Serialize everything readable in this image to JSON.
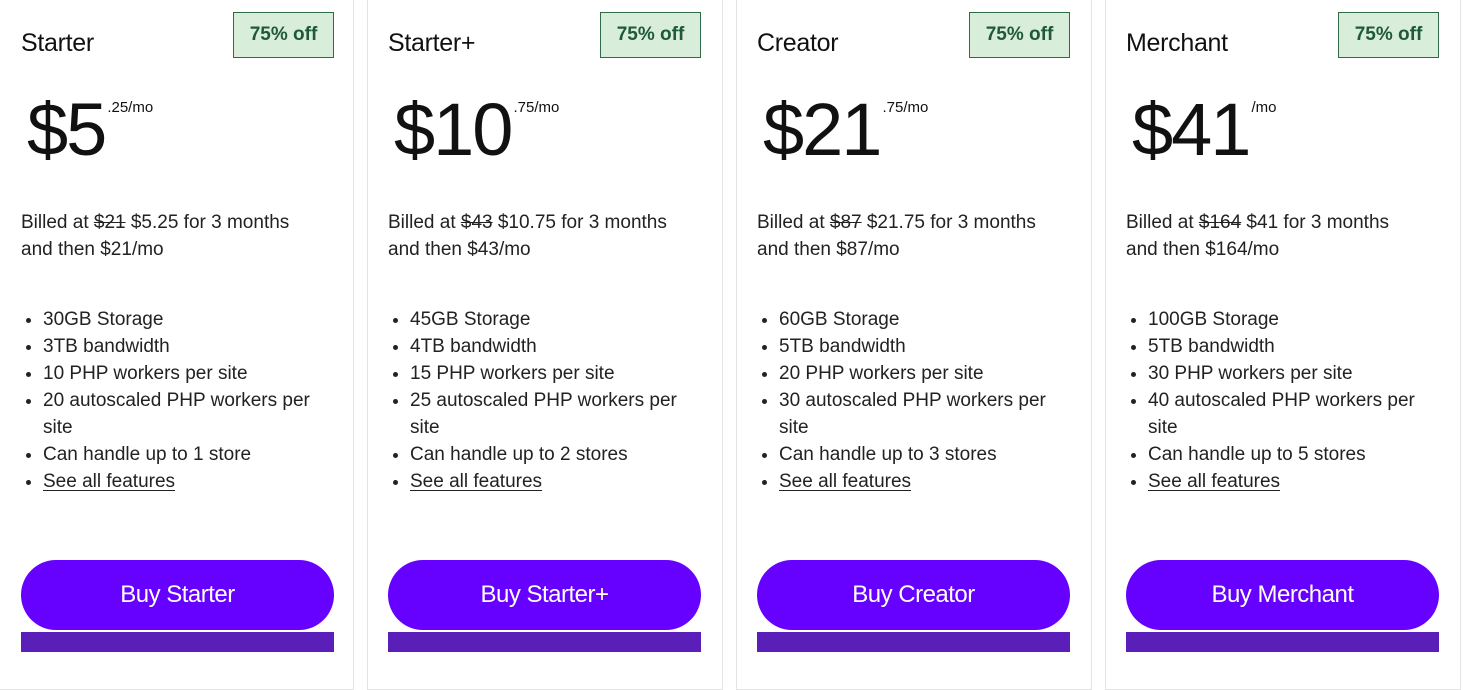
{
  "plans": [
    {
      "name": "Starter",
      "badge": "75% off",
      "price_main": "$5",
      "price_sup": ".25/mo",
      "billed_prefix": "Billed at ",
      "billed_old": "$21",
      "billed_rest": " $5.25 for 3 months",
      "billed_line2": "and then $21/mo",
      "features": [
        "30GB Storage",
        "3TB bandwidth",
        "10 PHP workers per site",
        "20 autoscaled PHP workers per site",
        "Can handle up to 1 store"
      ],
      "link": "See all features",
      "button": "Buy Starter"
    },
    {
      "name": "Starter+",
      "badge": "75% off",
      "price_main": "$10",
      "price_sup": ".75/mo",
      "billed_prefix": "Billed at ",
      "billed_old": "$43",
      "billed_rest": " $10.75 for 3 months",
      "billed_line2": "and then $43/mo",
      "features": [
        "45GB Storage",
        "4TB bandwidth",
        "15 PHP workers per site",
        "25 autoscaled PHP workers per site",
        "Can handle up to 2 stores"
      ],
      "link": "See all features",
      "button": "Buy Starter+"
    },
    {
      "name": "Creator",
      "badge": "75% off",
      "price_main": "$21",
      "price_sup": ".75/mo",
      "billed_prefix": "Billed at ",
      "billed_old": "$87",
      "billed_rest": " $21.75 for 3 months",
      "billed_line2": "and then $87/mo",
      "features": [
        "60GB Storage",
        "5TB bandwidth",
        "20 PHP workers per site",
        "30 autoscaled PHP workers per site",
        "Can handle up to 3 stores"
      ],
      "link": "See all features",
      "button": "Buy Creator"
    },
    {
      "name": "Merchant",
      "badge": "75% off",
      "price_main": "$41",
      "price_sup": "/mo",
      "billed_prefix": "Billed at ",
      "billed_old": "$164",
      "billed_rest": " $41 for 3 months",
      "billed_line2": "and then $164/mo",
      "features": [
        "100GB Storage",
        "5TB bandwidth",
        "30 PHP workers per site",
        "40 autoscaled PHP workers per site",
        "Can handle up to 5 stores"
      ],
      "link": "See all features",
      "button": "Buy Merchant"
    }
  ],
  "colors": {
    "accent": "#6600ff",
    "badge_bg": "#d8eedb",
    "badge_text": "#1f5a37"
  }
}
